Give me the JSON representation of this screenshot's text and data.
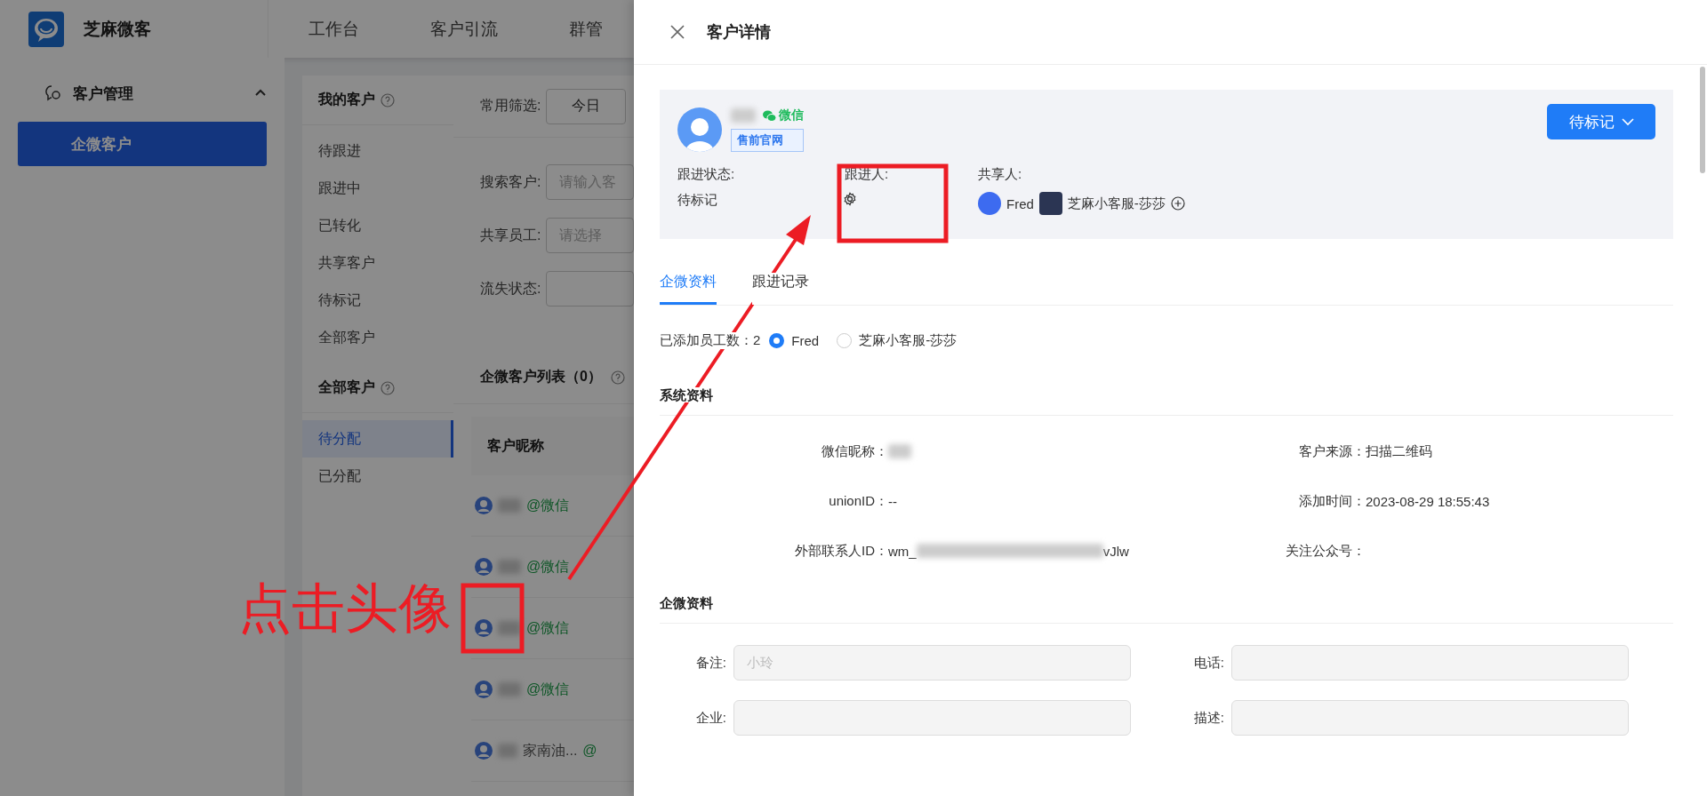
{
  "app": {
    "name": "芝麻微客",
    "nav": [
      {
        "label": "工作台"
      },
      {
        "label": "客户引流"
      },
      {
        "label": "群管"
      }
    ]
  },
  "sidebar": {
    "group": {
      "label": "客户管理",
      "expanded": true
    },
    "items": [
      {
        "label": "企微客户",
        "selected": true
      }
    ]
  },
  "subnav": {
    "sections": [
      {
        "title": "我的客户",
        "items": [
          {
            "label": "待跟进",
            "selected": false
          },
          {
            "label": "跟进中",
            "selected": false
          },
          {
            "label": "已转化",
            "selected": false
          },
          {
            "label": "共享客户",
            "selected": false
          },
          {
            "label": "待标记",
            "selected": false
          },
          {
            "label": "全部客户",
            "selected": false
          }
        ]
      },
      {
        "title": "全部客户",
        "items": [
          {
            "label": "待分配",
            "selected": true
          },
          {
            "label": "已分配",
            "selected": false
          }
        ]
      }
    ]
  },
  "filters": {
    "quick_label": "常用筛选:",
    "quick_options": [
      "今日"
    ],
    "fields": [
      {
        "label": "搜索客户:",
        "placeholder": "请输入客"
      },
      {
        "label": "共享员工:",
        "placeholder": "请选择"
      },
      {
        "label": "流失状态:"
      }
    ]
  },
  "list": {
    "title": "企微客户列表（0）",
    "columns": [
      "客户昵称"
    ],
    "rows": [
      {
        "channel": "@微信"
      },
      {
        "channel": "@微信"
      },
      {
        "channel": "@微信"
      },
      {
        "channel": "@微信"
      },
      {
        "text": "家南油...",
        "channel": "@"
      }
    ]
  },
  "drawer": {
    "title": "客户详情",
    "customer": {
      "channel": "微信",
      "tag": "售前官网",
      "status_button": "待标记"
    },
    "fields": [
      {
        "kind": "text",
        "label": "跟进状态:",
        "value": "待标记"
      },
      {
        "kind": "settings",
        "label": "跟进人:"
      },
      {
        "kind": "people",
        "label": "共享人:",
        "people": [
          {
            "name": "Fred"
          },
          {
            "name": "芝麻小客服-莎莎"
          }
        ]
      }
    ],
    "tabs": [
      {
        "label": "企微资料",
        "selected": true
      },
      {
        "label": "跟进记录",
        "selected": false
      }
    ],
    "staff": {
      "label": "已添加员工数：2",
      "members": [
        {
          "name": "Fred",
          "selected": true
        },
        {
          "name": "芝麻小客服-莎莎",
          "selected": false
        }
      ]
    },
    "system": {
      "title": "系统资料",
      "items": [
        {
          "kind": "blurred",
          "label": "微信昵称："
        },
        {
          "kind": "text",
          "label": "客户来源：",
          "value": "扫描二维码"
        },
        {
          "kind": "text",
          "label": "unionID：",
          "value": "--"
        },
        {
          "kind": "text",
          "label": "添加时间：",
          "value": "2023-08-29 18:55:43"
        },
        {
          "kind": "partial",
          "label": "外部联系人ID：",
          "prefix": "wm_",
          "suffix": "vJlw"
        },
        {
          "kind": "text",
          "label": "关注公众号："
        }
      ]
    },
    "form": {
      "title": "企微资料",
      "fields": [
        {
          "label": "备注:",
          "value": "小玲",
          "disabled": true
        },
        {
          "label": "电话:",
          "disabled": true
        },
        {
          "label": "企业:",
          "disabled": true
        },
        {
          "label": "描述:",
          "disabled": true
        }
      ]
    }
  },
  "annotation": {
    "label": "点击头像"
  }
}
